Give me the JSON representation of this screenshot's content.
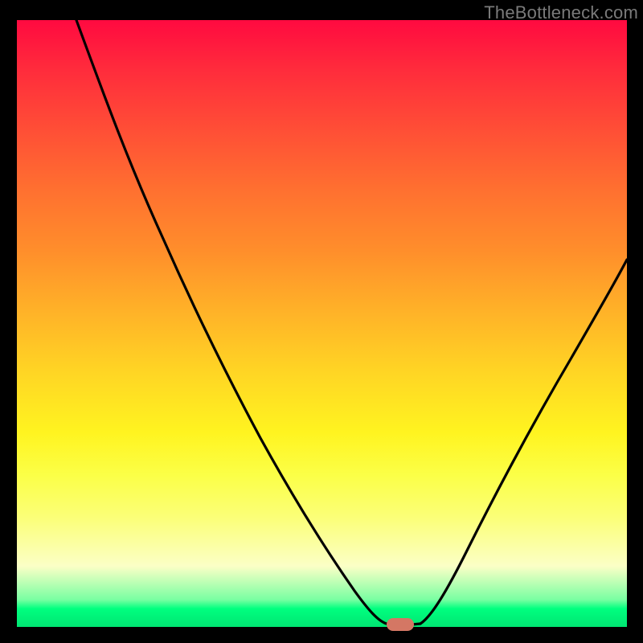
{
  "watermark": "TheBottleneck.com",
  "colors": {
    "page_bg": "#000000",
    "gradient_top": "#ff0a40",
    "gradient_bottom": "#00e572",
    "curve_stroke": "#000000",
    "marker": "#d47764",
    "watermark": "#7a7a7a"
  },
  "chart_data": {
    "type": "line",
    "title": "",
    "xlabel": "",
    "ylabel": "",
    "xlim": [
      0,
      100
    ],
    "ylim": [
      0,
      100
    ],
    "left_branch": {
      "x": [
        10,
        16,
        24,
        32,
        40,
        48,
        54,
        58,
        60.5
      ],
      "y": [
        100,
        86,
        70,
        54,
        39,
        23,
        10,
        3,
        0.5
      ]
    },
    "right_branch": {
      "x": [
        66,
        70,
        76,
        82,
        88,
        94,
        100
      ],
      "y": [
        1.5,
        6,
        16,
        28,
        40,
        51,
        61
      ]
    },
    "optimal_marker": {
      "x": 63,
      "y": 0.3
    },
    "notes": "V-shaped bottleneck curve; minimum around x≈63% where bottleneck ≈ 0%. Background heatmap encodes bottleneck severity (red=high, green=low)."
  }
}
